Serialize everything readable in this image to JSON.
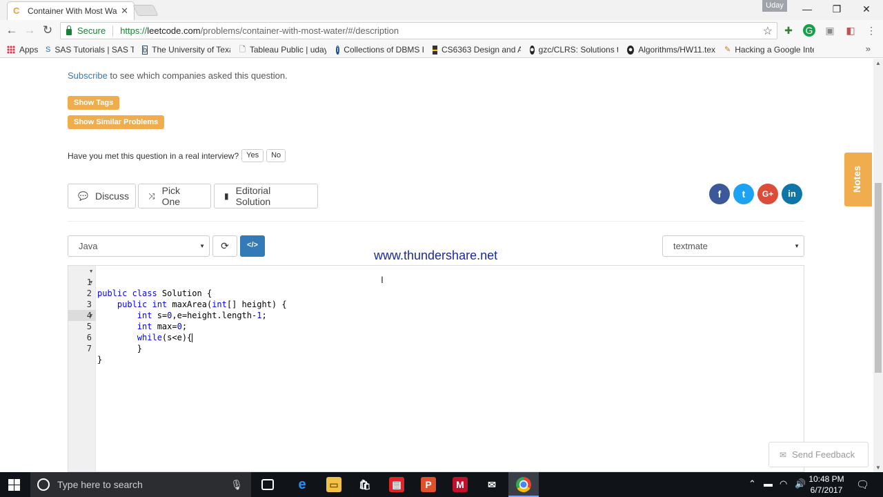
{
  "browser": {
    "tab_title": "Container With Most Wa",
    "profile": "Uday",
    "secure_label": "Secure",
    "url_prefix": "https://",
    "url_host": "leetcode.com",
    "url_path": "/problems/container-with-most-water/#/description"
  },
  "bookmarks": [
    {
      "label": "Apps"
    },
    {
      "label": "SAS Tutorials | SAS Tra"
    },
    {
      "label": "The University of Texa"
    },
    {
      "label": "Tableau Public | uday"
    },
    {
      "label": "Collections of DBMS I"
    },
    {
      "label": "CS6363 Design and A"
    },
    {
      "label": "gzc/CLRS: Solutions to"
    },
    {
      "label": "Algorithms/HW11.tex"
    },
    {
      "label": "Hacking a Google Inte"
    }
  ],
  "page": {
    "subscribe_link": "Subscribe",
    "subscribe_rest": " to see which companies asked this question.",
    "show_tags": "Show Tags",
    "show_similar": "Show Similar Problems",
    "interview_q": "Have you met this question in a real interview?",
    "yes": "Yes",
    "no": "No",
    "discuss": "Discuss",
    "pick_one": "Pick One",
    "editorial": "Editorial Solution",
    "language": "Java",
    "theme": "textmate",
    "watermark": "www.thundershare.net",
    "notes": "Notes",
    "feedback": "Send Feedback"
  },
  "code_lines": [
    "public class Solution {",
    "    public int maxArea(int[] height) {",
    "        int s=0,e=height.length-1;",
    "        int max=0;",
    "        while(s<e){",
    "        }",
    "}"
  ],
  "taskbar": {
    "search_placeholder": "Type here to search",
    "time": "10:48 PM",
    "date": "6/7/2017"
  },
  "colors": {
    "accent_orange": "#f0ad4e",
    "link_blue": "#337ab7",
    "facebook": "#3b5998",
    "twitter": "#1da1f2",
    "google_plus": "#dd4b39",
    "linkedin": "#0e76a8"
  }
}
